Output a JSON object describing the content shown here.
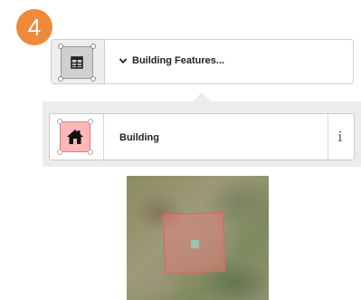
{
  "step": {
    "number": "4"
  },
  "preset_bar": {
    "title": "Building Features...",
    "icon": "area-grid-icon",
    "chevron_icon": "chevron-down-icon"
  },
  "preset_list": {
    "items": [
      {
        "label": "Building",
        "icon": "house-icon",
        "info_icon": "info-icon"
      }
    ]
  },
  "map": {
    "feature": "building-area"
  },
  "colors": {
    "badge": "#ee8a3c",
    "building_fill": "#fbb8b8",
    "building_stroke": "#e07a7a",
    "panel_bg": "#ececec"
  }
}
